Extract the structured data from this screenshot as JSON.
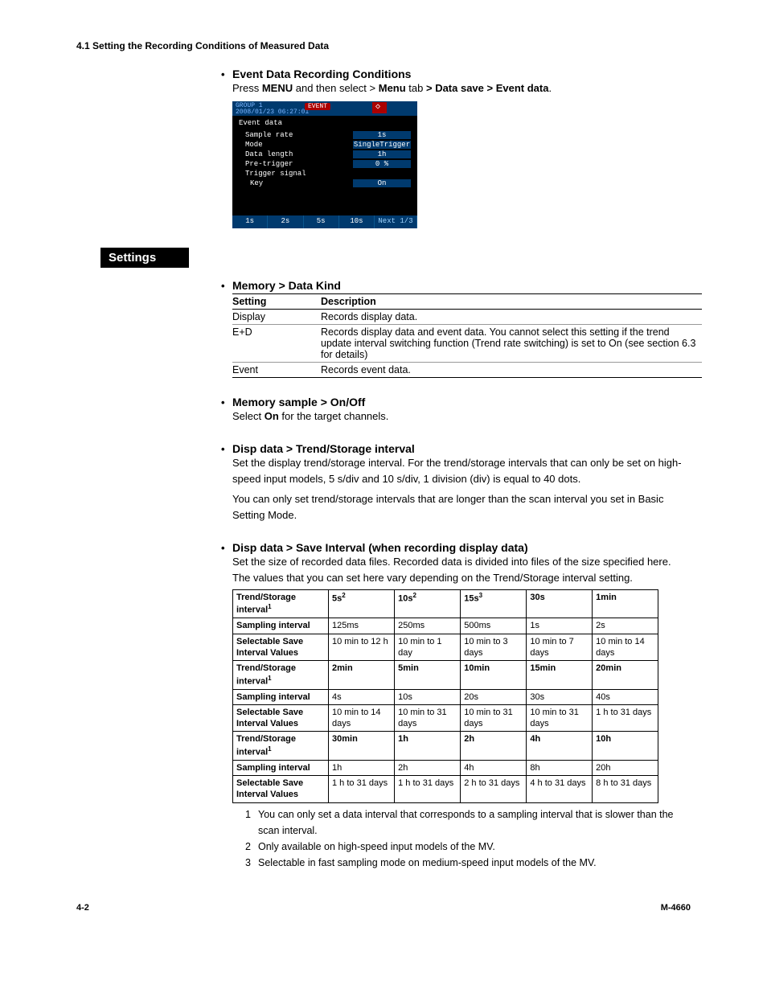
{
  "header": "4.1  Setting the Recording Conditions of Measured Data",
  "section1": {
    "title": "Event Data Recording Conditions",
    "line_parts": [
      "Press ",
      "MENU",
      " and then select > ",
      "Menu",
      " tab ",
      " > Data save > Event data",
      "."
    ]
  },
  "screenshot": {
    "group": "GROUP 1",
    "date": "2008/01/23 06:27:01",
    "badge": "EVENT",
    "title": "Event data",
    "rows": [
      {
        "l": "Sample rate",
        "v": "1s"
      },
      {
        "l": "Mode",
        "v": "SingleTrigger"
      },
      {
        "l": "Data length",
        "v": "1h"
      },
      {
        "l": "Pre-trigger",
        "v": "0    %"
      },
      {
        "l": "Trigger signal",
        "v": ""
      },
      {
        "l": "Key",
        "v": "On"
      }
    ],
    "foot": [
      "1s",
      "2s",
      "5s",
      "10s",
      "Next 1/3"
    ]
  },
  "settings_label": "Settings",
  "datakind": {
    "title": "Memory > Data Kind",
    "h1": "Setting",
    "h2": "Description",
    "rows": [
      {
        "s": "Display",
        "d": "Records display data."
      },
      {
        "s": "E+D",
        "d": "Records display data and event data. You cannot select this setting if the trend update interval switching function (Trend rate switching) is set to On (see section 6.3 for details)"
      },
      {
        "s": "Event",
        "d": "Records event data."
      }
    ]
  },
  "memorysample": {
    "title": "Memory sample > On/Off",
    "text_parts": [
      "Select ",
      "On",
      " for the target channels."
    ]
  },
  "trend": {
    "title": "Disp data > Trend/Storage interval",
    "para1": "Set the display trend/storage interval. For the trend/storage intervals that can only be set on high-speed input models, 5 s/div and 10 s/div, 1 division (div) is equal to 40 dots.",
    "para2": "You can only set trend/storage intervals that are longer than the scan interval you set in Basic Setting Mode."
  },
  "saveint": {
    "title": "Disp data > Save Interval (when recording display data)",
    "para": "Set the size of recorded data files. Recorded data is divided into files of the size specified here. The values that you can set here vary depending on the Trend/Storage interval setting."
  },
  "table_labels": {
    "ts": "Trend/Storage interval",
    "samp": "Sampling interval",
    "sel": "Selectable Save Interval Values"
  },
  "intervals": {
    "block1": {
      "ts": [
        "5s",
        "10s",
        "15s",
        "30s",
        "1min"
      ],
      "sup": [
        "2",
        "2",
        "3",
        "",
        ""
      ],
      "samp": [
        "125ms",
        "250ms",
        "500ms",
        "1s",
        "2s"
      ],
      "sel": [
        "10 min to 12 h",
        "10 min to 1 day",
        "10 min to 3 days",
        "10 min to 7 days",
        "10 min to 14 days"
      ]
    },
    "block2": {
      "ts": [
        "2min",
        "5min",
        "10min",
        "15min",
        "20min"
      ],
      "samp": [
        "4s",
        "10s",
        "20s",
        "30s",
        "40s"
      ],
      "sel": [
        "10 min to 14 days",
        "10 min to 31 days",
        "10 min to 31 days",
        "10 min to 31 days",
        "1 h to 31 days"
      ]
    },
    "block3": {
      "ts": [
        "30min",
        "1h",
        "2h",
        "4h",
        "10h"
      ],
      "samp": [
        "1h",
        "2h",
        "4h",
        "8h",
        "20h"
      ],
      "sel": [
        "1 h to 31 days",
        "1 h to 31 days",
        "2 h to 31 days",
        "4 h to 31 days",
        "8 h to 31 days"
      ]
    }
  },
  "notes": [
    "You can only set a data interval that corresponds to a sampling interval that is slower than the scan interval.",
    "Only available on high-speed input models of the MV.",
    "Selectable in fast sampling mode on medium-speed input models of the MV."
  ],
  "footer": {
    "left": "4-2",
    "right": "M-4660"
  }
}
